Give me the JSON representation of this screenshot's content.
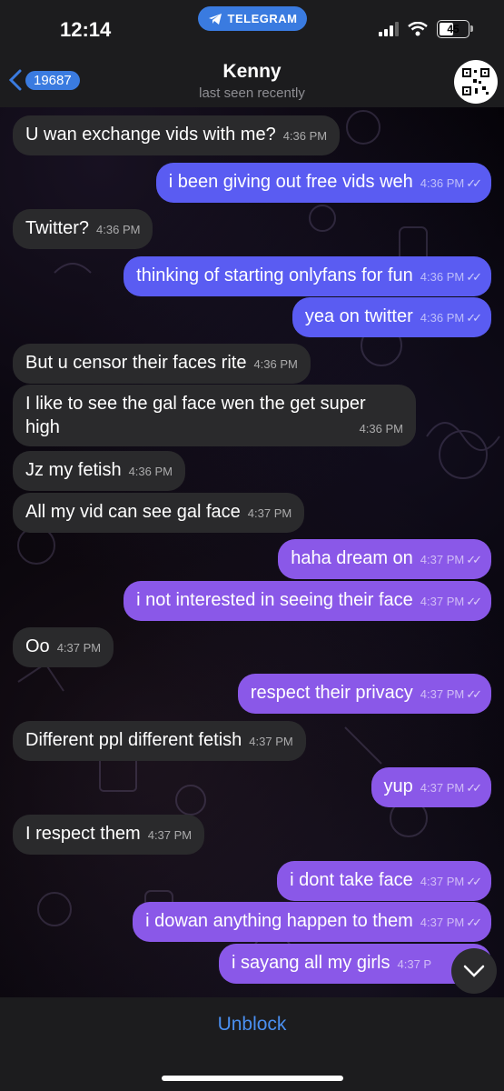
{
  "status": {
    "time": "12:14",
    "app_pill": "TELEGRAM",
    "battery": "45"
  },
  "header": {
    "back_count": "19687",
    "title": "Kenny",
    "subtitle": "last seen recently"
  },
  "messages": [
    {
      "text": "U wan exchange vids with me?",
      "time": "4:36 PM"
    },
    {
      "text": "i been giving out free vids weh",
      "time": "4:36 PM"
    },
    {
      "text": "Twitter?",
      "time": "4:36 PM"
    },
    {
      "text": "thinking of starting onlyfans for fun",
      "time": "4:36 PM"
    },
    {
      "text": "yea on twitter",
      "time": "4:36 PM"
    },
    {
      "text": "But u censor their faces rite",
      "time": "4:36 PM"
    },
    {
      "text": "I like to see the gal face wen the get super high",
      "time": "4:36 PM"
    },
    {
      "text": "Jz my fetish",
      "time": "4:36 PM"
    },
    {
      "text": "All my vid can see gal face",
      "time": "4:37 PM"
    },
    {
      "text": "haha dream on",
      "time": "4:37 PM"
    },
    {
      "text": "i not interested in seeing their face",
      "time": "4:37 PM"
    },
    {
      "text": "Oo",
      "time": "4:37 PM"
    },
    {
      "text": "respect their privacy",
      "time": "4:37 PM"
    },
    {
      "text": "Different ppl different fetish",
      "time": "4:37 PM"
    },
    {
      "text": "yup",
      "time": "4:37 PM"
    },
    {
      "text": "I respect them",
      "time": "4:37 PM"
    },
    {
      "text": "i dont take face",
      "time": "4:37 PM"
    },
    {
      "text": "i dowan anything happen to them",
      "time": "4:37 PM"
    },
    {
      "text": "i sayang all my girls",
      "time": "4:37 P"
    }
  ],
  "bottom": {
    "unblock_label": "Unblock"
  }
}
